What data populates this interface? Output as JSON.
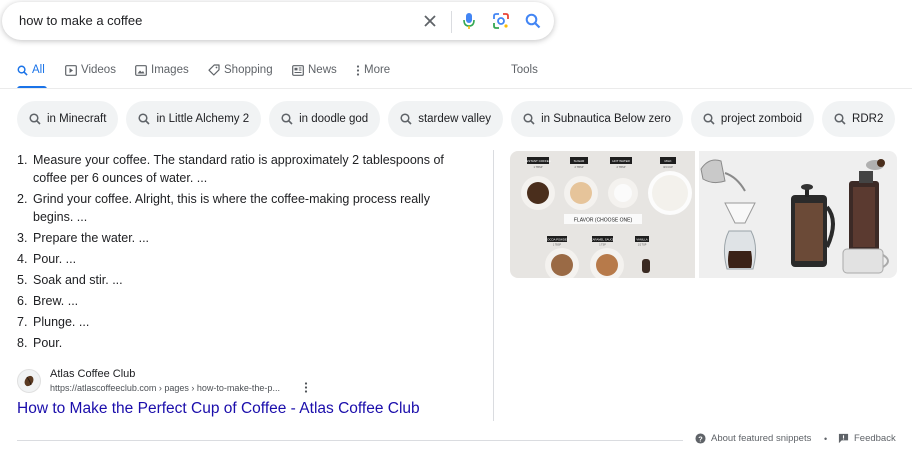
{
  "search": {
    "query": "how to make a coffee"
  },
  "tabs": [
    {
      "label": "All",
      "icon": "search-icon"
    },
    {
      "label": "Videos",
      "icon": "play-icon"
    },
    {
      "label": "Images",
      "icon": "image-icon"
    },
    {
      "label": "Shopping",
      "icon": "tag-icon"
    },
    {
      "label": "News",
      "icon": "newspaper-icon"
    },
    {
      "label": "More",
      "icon": "more-vertical-icon"
    }
  ],
  "tools_label": "Tools",
  "chips": [
    "in Minecraft",
    "in Little Alchemy 2",
    "in doodle god",
    "stardew valley",
    "in Subnautica Below zero",
    "project zomboid",
    "RDR2"
  ],
  "steps": [
    {
      "num": "1.",
      "text": "Measure your coffee. The standard ratio is approximately 2 tablespoons of coffee per 6 ounces of water. ..."
    },
    {
      "num": "2.",
      "text": "Grind your coffee. Alright, this is where the coffee-making process really begins. ..."
    },
    {
      "num": "3.",
      "text": "Prepare the water. ..."
    },
    {
      "num": "4.",
      "text": "Pour. ..."
    },
    {
      "num": "5.",
      "text": "Soak and stir. ..."
    },
    {
      "num": "6.",
      "text": "Brew. ..."
    },
    {
      "num": "7.",
      "text": "Plunge. ..."
    },
    {
      "num": "8.",
      "text": "Pour."
    }
  ],
  "image_left_labels": {
    "top": [
      "INSTANT COFFEE",
      "SUGAR",
      "HOT WATER",
      "MILK"
    ],
    "sub_top": [
      "1 TBSP",
      "2 TBSP",
      "2 TBSP",
      "3/4 CUP"
    ],
    "flavor": "FLAVOR (CHOOSE ONE)",
    "bottom": [
      "COCOA POWDER",
      "CARAMEL SAUCE",
      "VANILLA"
    ],
    "sub_bottom": [
      "1 TBSP",
      "1 TSP",
      "1/2 TSP"
    ]
  },
  "source": {
    "name": "Atlas Coffee Club",
    "url": "https://atlascoffeeclub.com › pages › how-to-make-the-p...",
    "title": "How to Make the Perfect Cup of Coffee - Atlas Coffee Club"
  },
  "footer": {
    "about": "About featured snippets",
    "separator": "•",
    "feedback": "Feedback"
  },
  "colors": {
    "accent": "#1a73e8",
    "link": "#1a0dab",
    "chip_bg": "#f1f3f4"
  }
}
